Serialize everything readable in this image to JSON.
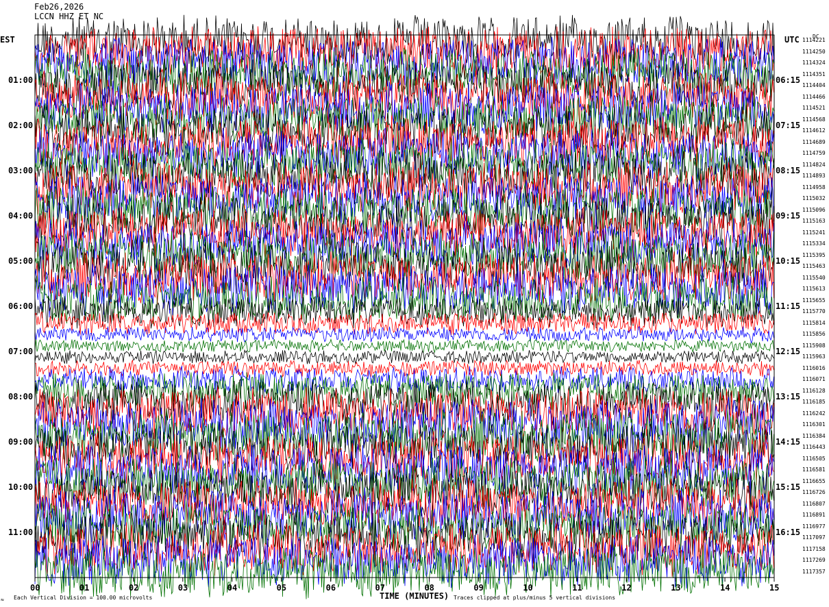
{
  "header": {
    "date": "Feb26,2026",
    "station": "LCCN HHZ ET NC"
  },
  "left_axis_title": "EST",
  "right_axis_title": "UTC",
  "right_top_tag": "DC",
  "footer": {
    "scale_note": "Each Vertical Division = 100.00 microvolts",
    "xlabel": "TIME (MINUTES)",
    "clip_note": "Traces clipped at plus/minus 5 vertical divisions",
    "corner_mark": "≈"
  },
  "chart_data": {
    "type": "line",
    "title": "Feb26,2026",
    "xlabel": "TIME (MINUTES)",
    "ylabel": "EST",
    "x_ticks": [
      "00",
      "01",
      "02",
      "03",
      "04",
      "05",
      "06",
      "07",
      "08",
      "09",
      "10",
      "11",
      "12",
      "13",
      "14",
      "15"
    ],
    "xlim": [
      0,
      15
    ],
    "est_labels": [
      "01:00",
      "02:00",
      "03:00",
      "04:00",
      "05:00",
      "06:00",
      "07:00",
      "08:00",
      "09:00",
      "10:00",
      "11:00"
    ],
    "utc_labels": [
      "06:15",
      "07:15",
      "08:15",
      "09:15",
      "10:15",
      "11:15",
      "12:15",
      "13:15",
      "14:15",
      "15:15",
      "16:15"
    ],
    "trace_counts": [
      "1114221",
      "1114250",
      "1114324",
      "1114351",
      "1114404",
      "1114466",
      "1114521",
      "1114568",
      "1114612",
      "1114689",
      "1114759",
      "1114824",
      "1114893",
      "1114958",
      "1115032",
      "1115096",
      "1115163",
      "1115241",
      "1115334",
      "1115395",
      "1115463",
      "1115540",
      "1115613",
      "1115655",
      "1115770",
      "1115814",
      "1115856",
      "1115908",
      "1115963",
      "1116016",
      "1116071",
      "1116128",
      "1116185",
      "1116242",
      "1116301",
      "1116384",
      "1116443",
      "1116505",
      "1116581",
      "1116655",
      "1116726",
      "1116807",
      "1116891",
      "1116977",
      "1117097",
      "1117158",
      "1117269",
      "1117357"
    ],
    "trace_colors": [
      "#000000",
      "#ff0000",
      "#0000ff",
      "#007000"
    ],
    "trace_amplitude": [
      5,
      5,
      5,
      5,
      5,
      5,
      5,
      5,
      5,
      5,
      5,
      5,
      5,
      5,
      5,
      5,
      5,
      5,
      5,
      5,
      5,
      5,
      5,
      4.5,
      3,
      2.2,
      1.5,
      1.2,
      1.3,
      1.6,
      2.5,
      3.5,
      4.5,
      5,
      5,
      5,
      5,
      5,
      5,
      5,
      5,
      5,
      5,
      5,
      5,
      5,
      5,
      5
    ],
    "clip_divisions": 5,
    "division_microvolts": 100.0
  }
}
